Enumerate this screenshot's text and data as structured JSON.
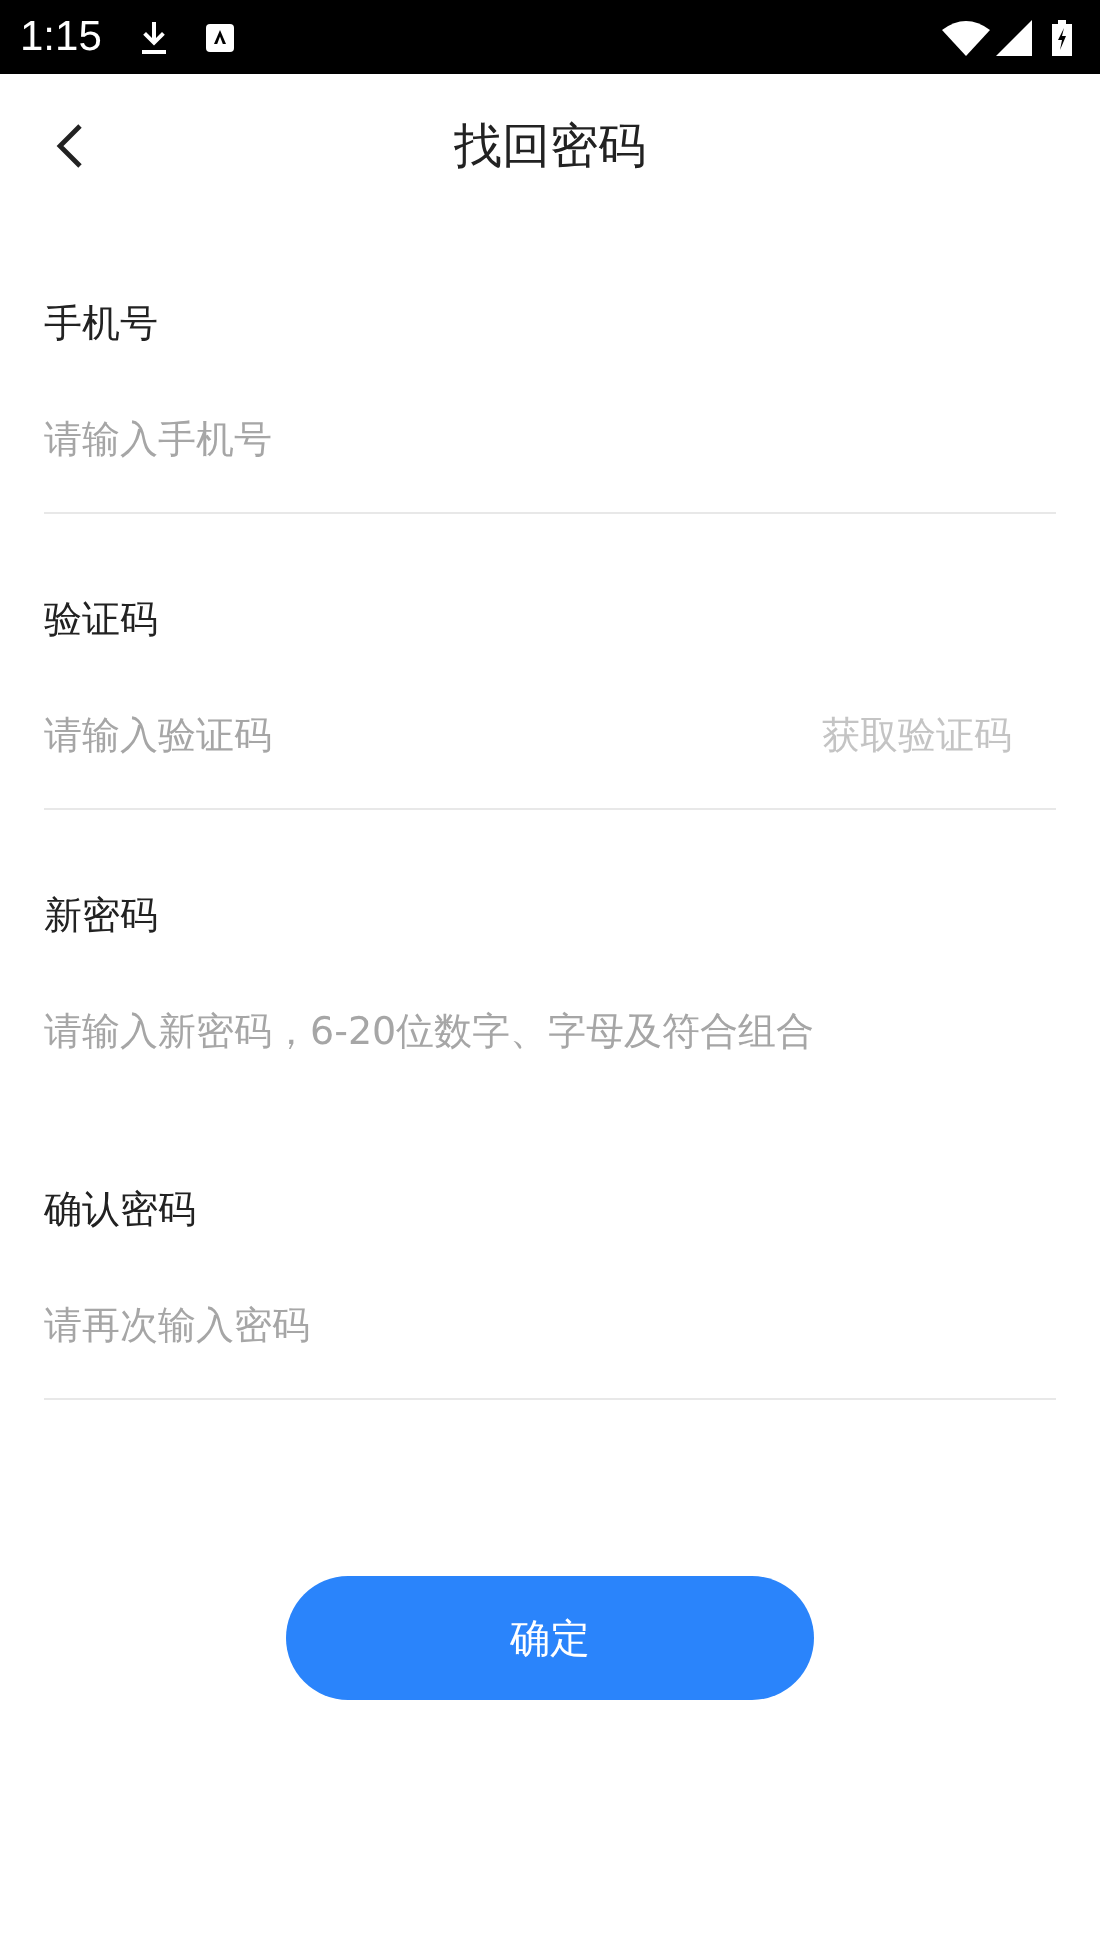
{
  "status_bar": {
    "time": "1:15"
  },
  "header": {
    "title": "找回密码"
  },
  "fields": [
    {
      "label": "手机号",
      "placeholder": "请输入手机号",
      "divider": true
    },
    {
      "label": "验证码",
      "placeholder": "请输入验证码",
      "divider": true,
      "action": {
        "label": "获取验证码",
        "disabled": true
      }
    },
    {
      "label": "新密码",
      "placeholder": "请输入新密码，6-20位数字、字母及符合组合",
      "divider": false
    },
    {
      "label": "确认密码",
      "placeholder": "请再次输入密码",
      "divider": true
    }
  ],
  "submit": {
    "label": "确定"
  }
}
